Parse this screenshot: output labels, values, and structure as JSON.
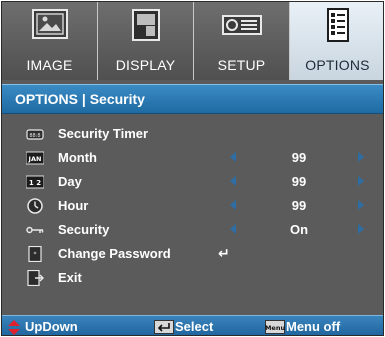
{
  "tabs": [
    {
      "label": "IMAGE",
      "icon": "image-icon",
      "active": false
    },
    {
      "label": "DISPLAY",
      "icon": "display-icon",
      "active": false
    },
    {
      "label": "SETUP",
      "icon": "setup-icon",
      "active": false
    },
    {
      "label": "OPTIONS",
      "icon": "options-icon",
      "active": true
    }
  ],
  "header": {
    "title": "OPTIONS | Security"
  },
  "menu": {
    "items": [
      {
        "label": "Security Timer",
        "icon": "timer-icon"
      },
      {
        "label": "Month",
        "icon": "calendar-month-icon",
        "icon_text": "JAN",
        "value": "99"
      },
      {
        "label": "Day",
        "icon": "calendar-day-icon",
        "icon_text": "1 2",
        "value": "99"
      },
      {
        "label": "Hour",
        "icon": "clock-icon",
        "value": "99"
      },
      {
        "label": "Security",
        "icon": "key-icon",
        "value": "On"
      },
      {
        "label": "Change Password",
        "icon": "password-icon",
        "enter": "↵"
      },
      {
        "label": "Exit",
        "icon": "exit-icon"
      }
    ]
  },
  "footer": {
    "updown": "UpDown",
    "select": "Select",
    "menu_off": "Menu off",
    "menu_key_text": "Menu"
  },
  "colors": {
    "background": "#5b5b5b",
    "accent": "#1f6aa3",
    "arrow": "#2f6ea5",
    "updown_icon": "#e0212d"
  }
}
